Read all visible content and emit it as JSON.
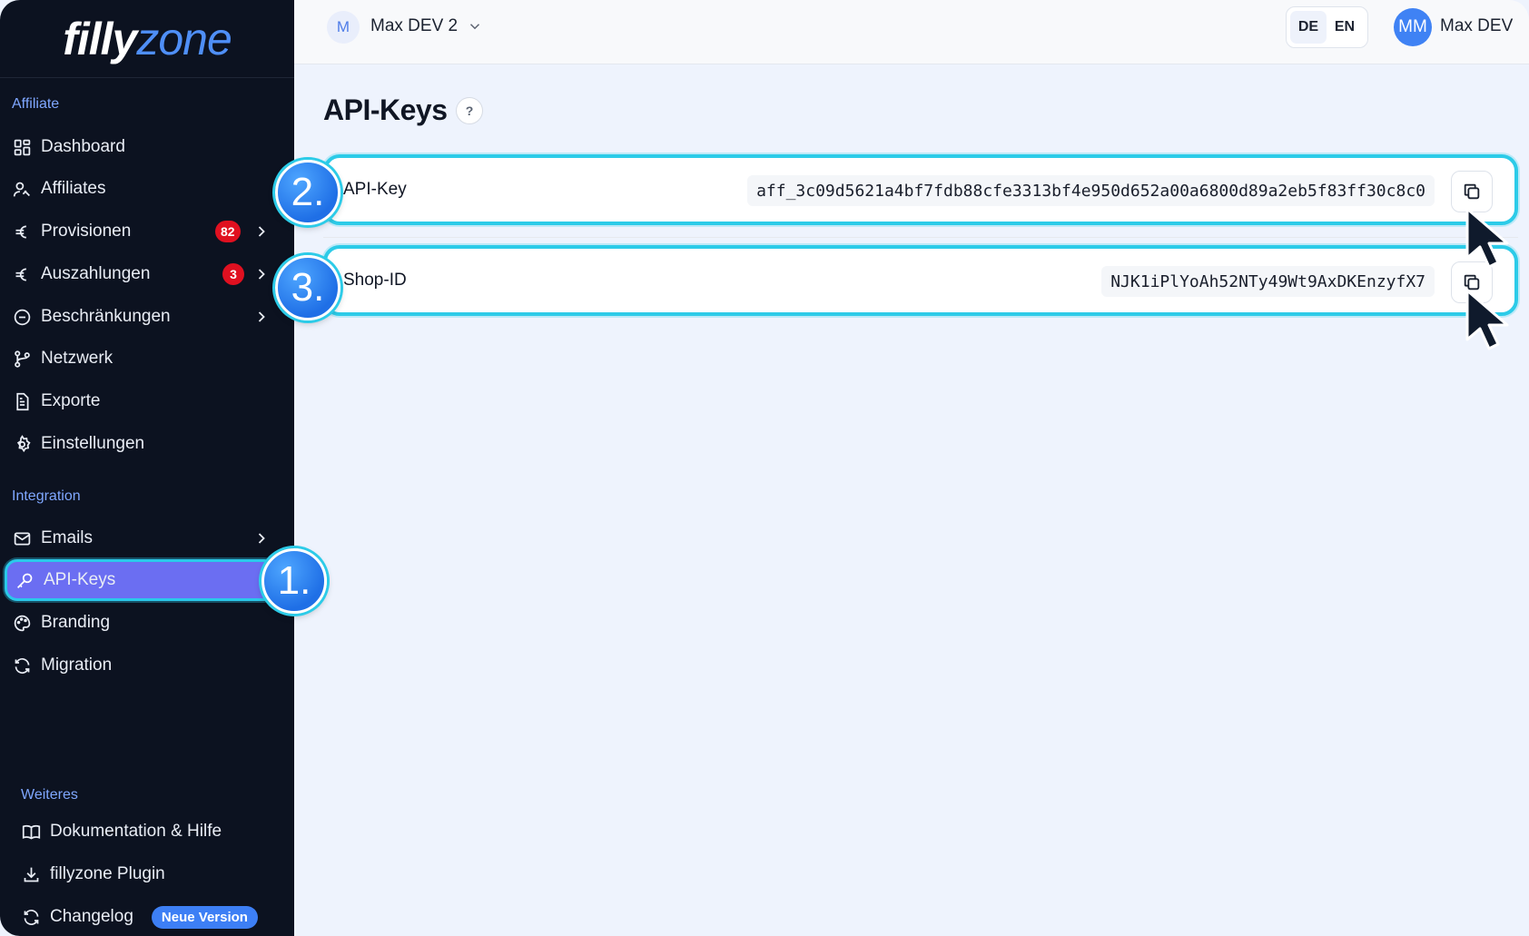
{
  "brand": {
    "logo_part1": "filly",
    "logo_part2": "zone"
  },
  "sidebar": {
    "section_affiliate": "Affiliate",
    "items": [
      {
        "label": "Dashboard",
        "icon": "dashboard-grid-icon"
      },
      {
        "label": "Affiliates",
        "icon": "users-icon"
      },
      {
        "label": "Provisionen",
        "icon": "euro-icon",
        "badge": "82"
      },
      {
        "label": "Auszahlungen",
        "icon": "euro-icon",
        "badge": "3"
      },
      {
        "label": "Beschränkungen",
        "icon": "minus-circle-icon"
      },
      {
        "label": "Netzwerk",
        "icon": "network-branch-icon"
      },
      {
        "label": "Exporte",
        "icon": "document-icon"
      },
      {
        "label": "Einstellungen",
        "icon": "gear-icon"
      }
    ],
    "section_integration": "Integration",
    "integration_items": [
      {
        "label": "Emails",
        "icon": "mail-icon"
      },
      {
        "label": "API-Keys",
        "icon": "key-icon"
      },
      {
        "label": "Branding",
        "icon": "palette-icon"
      },
      {
        "label": "Migration",
        "icon": "refresh-icon"
      }
    ],
    "section_more": "Weiteres",
    "footer_items": [
      {
        "label": "Dokumentation & Hilfe",
        "icon": "book-icon"
      },
      {
        "label": "fillyzone Plugin",
        "icon": "download-icon"
      },
      {
        "label": "Changelog",
        "icon": "refresh-icon",
        "pill": "Neue Version"
      }
    ]
  },
  "topbar": {
    "workspace_initial": "M",
    "workspace_name": "Max DEV 2",
    "lang_de": "DE",
    "lang_en": "EN",
    "user_initials": "MM",
    "user_name": "Max DEV"
  },
  "main": {
    "title": "API-Keys",
    "help": "?",
    "rows": [
      {
        "label": "API-Key",
        "value": "aff_3c09d5621a4bf7fdb88cfe3313bf4e950d652a00a6800d89a2eb5f83ff30c8c0"
      },
      {
        "label": "Shop-ID",
        "value": "NJK1iPlYoAh52NTy49Wt9AxDKEnzyfX7"
      }
    ]
  },
  "steps": [
    "1.",
    "2.",
    "3."
  ],
  "colors": {
    "sidebar_bg": "#0c1220",
    "active_bg": "#6b6ef2",
    "highlight": "#2ccbe8",
    "accent": "#3f82f4",
    "badge": "#e01020"
  }
}
